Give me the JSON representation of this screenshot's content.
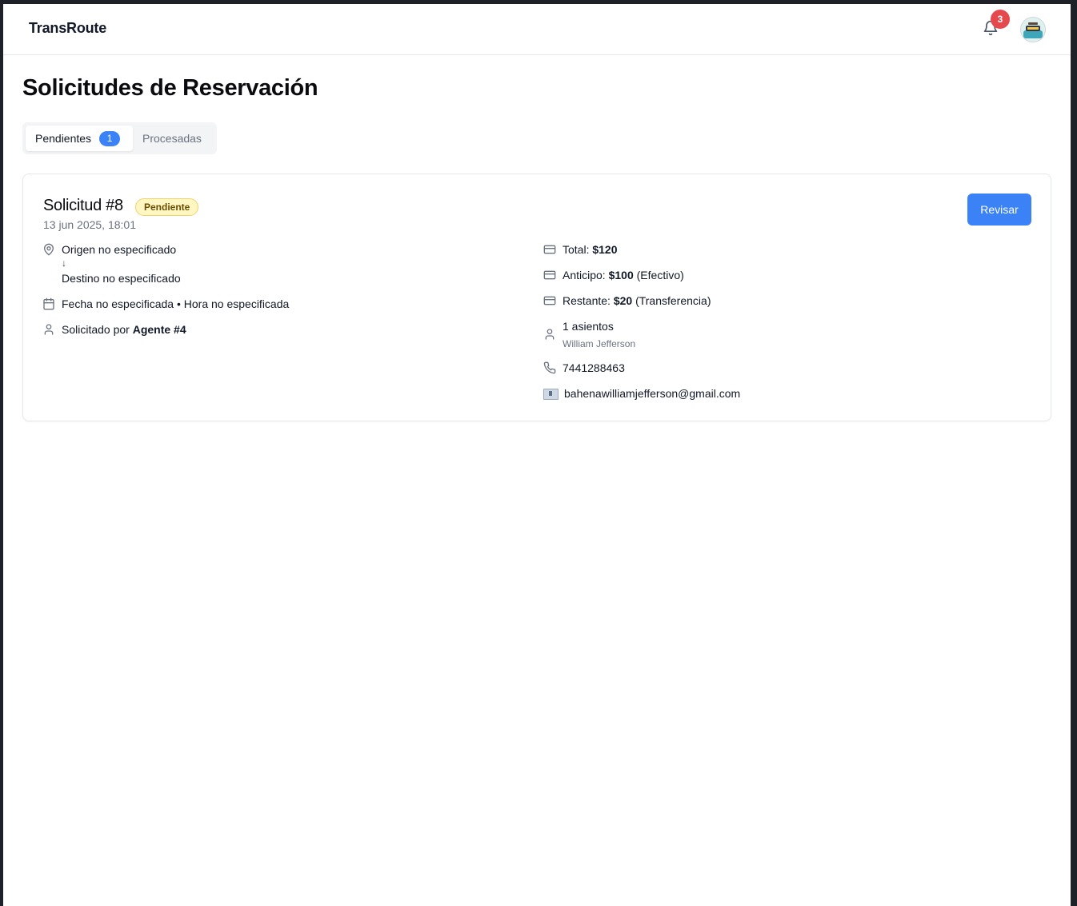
{
  "app": {
    "brand": "TransRoute",
    "notifications_count": "3"
  },
  "page": {
    "title": "Solicitudes de Reservación"
  },
  "tabs": [
    {
      "label": "Pendientes",
      "count": "1",
      "active": true
    },
    {
      "label": "Procesadas",
      "active": false
    }
  ],
  "request": {
    "title": "Solicitud #8",
    "status": "Pendiente",
    "datetime": "13 jun 2025, 18:01",
    "review_label": "Revisar",
    "origin": "Origen no especificado",
    "arrow": "↓",
    "destination": "Destino no especificado",
    "date_time_text": "Fecha no especificada • Hora no especificada",
    "requested_by_prefix": "Solicitado por ",
    "requested_by_agent": "Agente #4",
    "total_label": "Total: ",
    "total_value": "$120",
    "advance_label": "Anticipo: ",
    "advance_value": "$100",
    "advance_method": " (Efectivo)",
    "remaining_label": "Restante: ",
    "remaining_value": "$20",
    "remaining_method": " (Transferencia)",
    "seats": "1 asientos",
    "passenger": "William Jefferson",
    "phone": "7441288463",
    "email": "bahenawilliamjefferson@gmail.com"
  },
  "colors": {
    "accent": "#3b82f6",
    "notification_badge": "#e5484d",
    "status_badge_bg": "#fef7c3",
    "status_badge_border": "#f1d36a"
  },
  "icons": {
    "bell": "bell-icon",
    "origin": "map-pin-icon",
    "date": "calendar-icon",
    "agent": "user-icon",
    "money": "credit-card-icon",
    "seats": "user-icon",
    "phone": "phone-icon",
    "email": "envelope-icon"
  }
}
